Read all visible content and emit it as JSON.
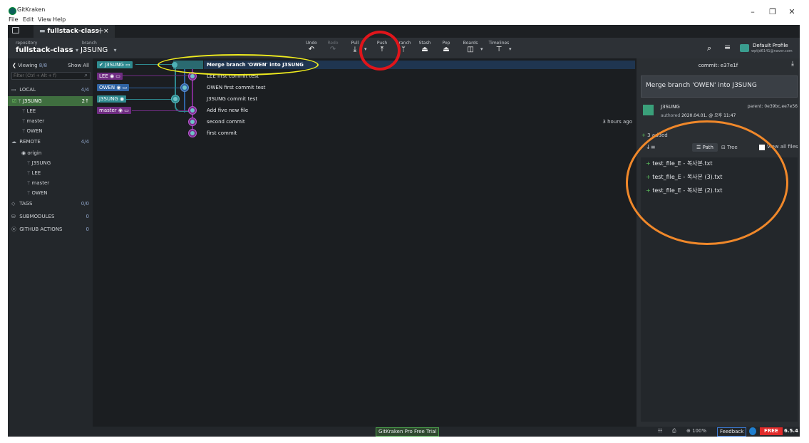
{
  "window": {
    "title": "GitKraken",
    "menu": [
      "File",
      "Edit",
      "View",
      "Help"
    ]
  },
  "tab": {
    "name": "fullstack-class",
    "close": "×",
    "add": "+"
  },
  "toolbar": {
    "repository_label": "repository",
    "repository": "fullstack-class",
    "branch_label": "branch",
    "branch": "J3SUNG",
    "buttons": [
      {
        "label": "Undo",
        "icon": "undo-icon",
        "glyph": "↶"
      },
      {
        "label": "Redo",
        "icon": "redo-icon",
        "glyph": "↷"
      },
      {
        "label": "Pull",
        "icon": "pull-icon",
        "glyph": "⤓"
      },
      {
        "label": "Push",
        "icon": "push-icon",
        "glyph": "⤒"
      },
      {
        "label": "Branch",
        "icon": "branch-icon",
        "glyph": "ᛘ"
      },
      {
        "label": "Stash",
        "icon": "stash-icon",
        "glyph": "⏏"
      },
      {
        "label": "Pop",
        "icon": "pop-icon",
        "glyph": "⏏"
      },
      {
        "label": "Boards",
        "icon": "boards-icon",
        "glyph": "◫"
      },
      {
        "label": "Timelines",
        "icon": "timelines-icon",
        "glyph": "⊤"
      }
    ],
    "profile_name": "Default Profile",
    "profile_email": "wptjd6141@naver.com"
  },
  "left_panel": {
    "viewing_label": "Viewing",
    "viewing_count": "8/8",
    "show_all": "Show All",
    "filter_placeholder": "Filter (Ctrl + Alt + f)",
    "local": {
      "label": "LOCAL",
      "count": "4/4",
      "branches": [
        {
          "name": "J3SUNG",
          "badge": "2↑"
        },
        {
          "name": "LEE"
        },
        {
          "name": "master"
        },
        {
          "name": "OWEN"
        }
      ]
    },
    "remote": {
      "label": "REMOTE",
      "count": "4/4",
      "origin": "origin",
      "branches": [
        "J3SUNG",
        "LEE",
        "master",
        "OWEN"
      ]
    },
    "tags": {
      "label": "TAGS",
      "count": "0/0"
    },
    "submodules": {
      "label": "SUBMODULES",
      "count": "0"
    },
    "github_actions": {
      "label": "GITHUB ACTIONS",
      "count": "0"
    }
  },
  "graph": {
    "refs": [
      {
        "label": "J3SUNG",
        "color": "#2e8a8f"
      },
      {
        "label": "LEE",
        "color": "#6f2c82"
      },
      {
        "label": "OWEN",
        "color": "#2f63a3"
      },
      {
        "label": "J3SUNG",
        "color": "#2e8a8f"
      },
      {
        "label": "master",
        "color": "#6f2c82"
      }
    ],
    "commits": [
      {
        "message": "Merge branch 'OWEN' into J3SUNG",
        "time": ""
      },
      {
        "message": "LEE first commit test",
        "time": ""
      },
      {
        "message": "OWEN first commit test",
        "time": ""
      },
      {
        "message": "J3SUNG commit test",
        "time": ""
      },
      {
        "message": "Add five new file",
        "time": ""
      },
      {
        "message": "second commit",
        "time": "3 hours ago"
      },
      {
        "message": "first commit",
        "time": ""
      }
    ]
  },
  "right_panel": {
    "commit_label": "commit: e37e1f",
    "commit_message": "Merge branch 'OWEN' into J3SUNG",
    "author": "J3SUNG",
    "parent": "parent: 0e39bc,ee7e56",
    "authored": "authored",
    "authored_date": "2020.04.01. @ 오후 11:47",
    "added_summary": "3 added",
    "path_label": "Path",
    "tree_label": "Tree",
    "view_all_files": "View all files",
    "files": [
      "test_file_E - 복사본.txt",
      "test_file_E - 복사본 (3).txt",
      "test_file_E - 복사본 (2).txt"
    ]
  },
  "status_bar": {
    "trial": "GitKraken Pro Free Trial",
    "zoom": "100%",
    "feedback": "Feedback",
    "plan": "FREE",
    "version": "6.5.4"
  },
  "annotations": {
    "yellow": "#f0ec1e",
    "red": "#e0151b",
    "orange": "#f0882a"
  }
}
